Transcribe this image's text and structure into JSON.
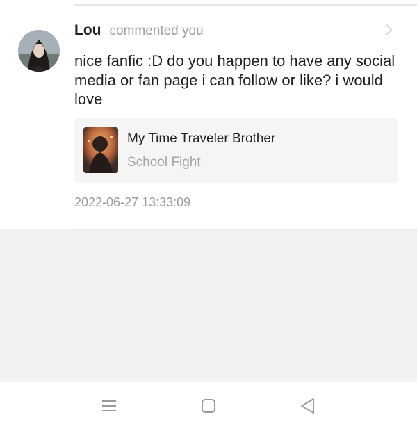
{
  "notification": {
    "username": "Lou",
    "action": "commented you",
    "comment": "nice fanfic :D do you happen to have any social media or fan page i can follow or like? i would love",
    "work": {
      "title": "My Time Traveler Brother",
      "subtitle": "School Fight"
    },
    "timestamp": "2022-06-27 13:33:09"
  },
  "navbar": {
    "icons": [
      "menu-icon",
      "home-square-icon",
      "back-triangle-icon"
    ]
  },
  "colors": {
    "background": "#f2f2f2",
    "card": "#ffffff",
    "text_primary": "#1f1f1f",
    "text_secondary": "#9a9a9a",
    "work_card_bg": "#f5f5f5"
  }
}
